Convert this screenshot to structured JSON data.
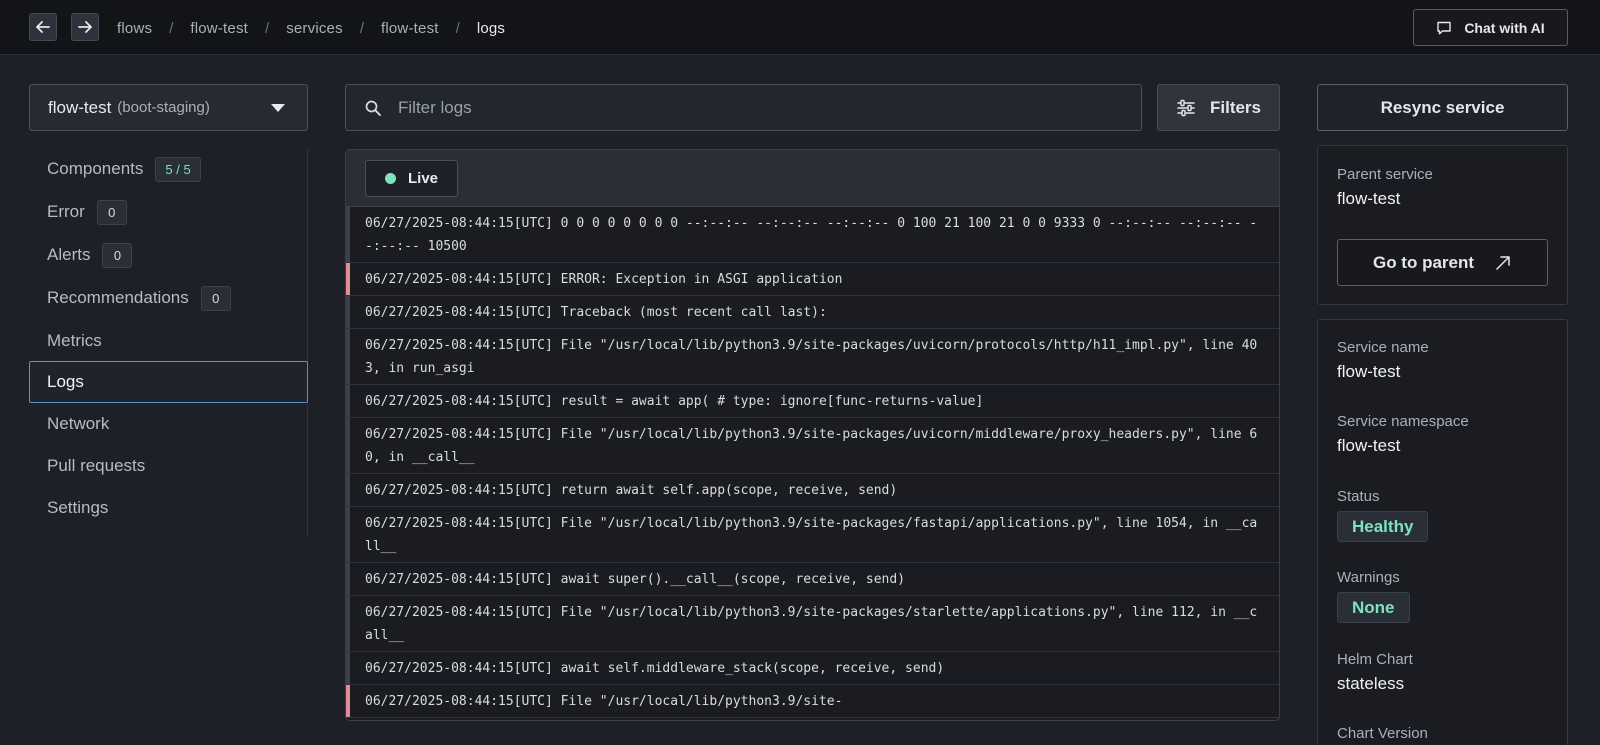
{
  "nav": {
    "back_icon": "arrow-left-icon",
    "forward_icon": "arrow-right-icon",
    "breadcrumbs": [
      "flows",
      "flow-test",
      "services",
      "flow-test",
      "logs"
    ],
    "separator": "/",
    "chat_button": "Chat with AI"
  },
  "service_selector": {
    "name": "flow-test",
    "environment": "(boot-staging)"
  },
  "sidebar": {
    "items": [
      {
        "label": "Components",
        "badge": "5 / 5"
      },
      {
        "label": "Error",
        "badge": "0"
      },
      {
        "label": "Alerts",
        "badge": "0"
      },
      {
        "label": "Recommendations",
        "badge": "0"
      },
      {
        "label": "Metrics"
      },
      {
        "label": "Logs",
        "active": true
      },
      {
        "label": "Network"
      },
      {
        "label": "Pull requests"
      },
      {
        "label": "Settings"
      }
    ]
  },
  "logs": {
    "filter_placeholder": "Filter logs",
    "filters_button": "Filters",
    "live_label": "Live",
    "lines": [
      {
        "text": "06/27/2025-08:44:15[UTC] 0 0 0 0 0 0 0 0 --:--:-- --:--:-- --:--:-- 0 100 21 100 21 0 0 9333 0 --:--:-- --:--:-- --:--:-- 10500",
        "level": "info"
      },
      {
        "text": "06/27/2025-08:44:15[UTC] ERROR: Exception in ASGI application",
        "level": "error"
      },
      {
        "text": "06/27/2025-08:44:15[UTC] Traceback (most recent call last):",
        "level": "info"
      },
      {
        "text": "06/27/2025-08:44:15[UTC] File \"/usr/local/lib/python3.9/site-packages/uvicorn/protocols/http/h11_impl.py\", line 403, in run_asgi",
        "level": "info"
      },
      {
        "text": "06/27/2025-08:44:15[UTC] result = await app( # type: ignore[func-returns-value]",
        "level": "info"
      },
      {
        "text": "06/27/2025-08:44:15[UTC] File \"/usr/local/lib/python3.9/site-packages/uvicorn/middleware/proxy_headers.py\", line 60, in __call__",
        "level": "info"
      },
      {
        "text": "06/27/2025-08:44:15[UTC] return await self.app(scope, receive, send)",
        "level": "info"
      },
      {
        "text": "06/27/2025-08:44:15[UTC] File \"/usr/local/lib/python3.9/site-packages/fastapi/applications.py\", line 1054, in __call__",
        "level": "info"
      },
      {
        "text": "06/27/2025-08:44:15[UTC] await super().__call__(scope, receive, send)",
        "level": "info"
      },
      {
        "text": "06/27/2025-08:44:15[UTC] File \"/usr/local/lib/python3.9/site-packages/starlette/applications.py\", line 112, in __call__",
        "level": "info"
      },
      {
        "text": "06/27/2025-08:44:15[UTC] await self.middleware_stack(scope, receive, send)",
        "level": "info"
      },
      {
        "text": "06/27/2025-08:44:15[UTC] File \"/usr/local/lib/python3.9/site-",
        "level": "error"
      }
    ]
  },
  "right_panel": {
    "resync_button": "Resync service",
    "parent": {
      "label": "Parent service",
      "value": "flow-test",
      "button": "Go to parent"
    },
    "details": {
      "service_name_label": "Service name",
      "service_name": "flow-test",
      "namespace_label": "Service namespace",
      "namespace": "flow-test",
      "status_label": "Status",
      "status": "Healthy",
      "warnings_label": "Warnings",
      "warnings": "None",
      "helm_label": "Helm Chart",
      "helm": "stateless",
      "chart_version_label": "Chart Version"
    }
  },
  "colors": {
    "accent_green": "#7de3be",
    "error_marker": "#e28a96",
    "active_border": "#5e8fcf"
  }
}
